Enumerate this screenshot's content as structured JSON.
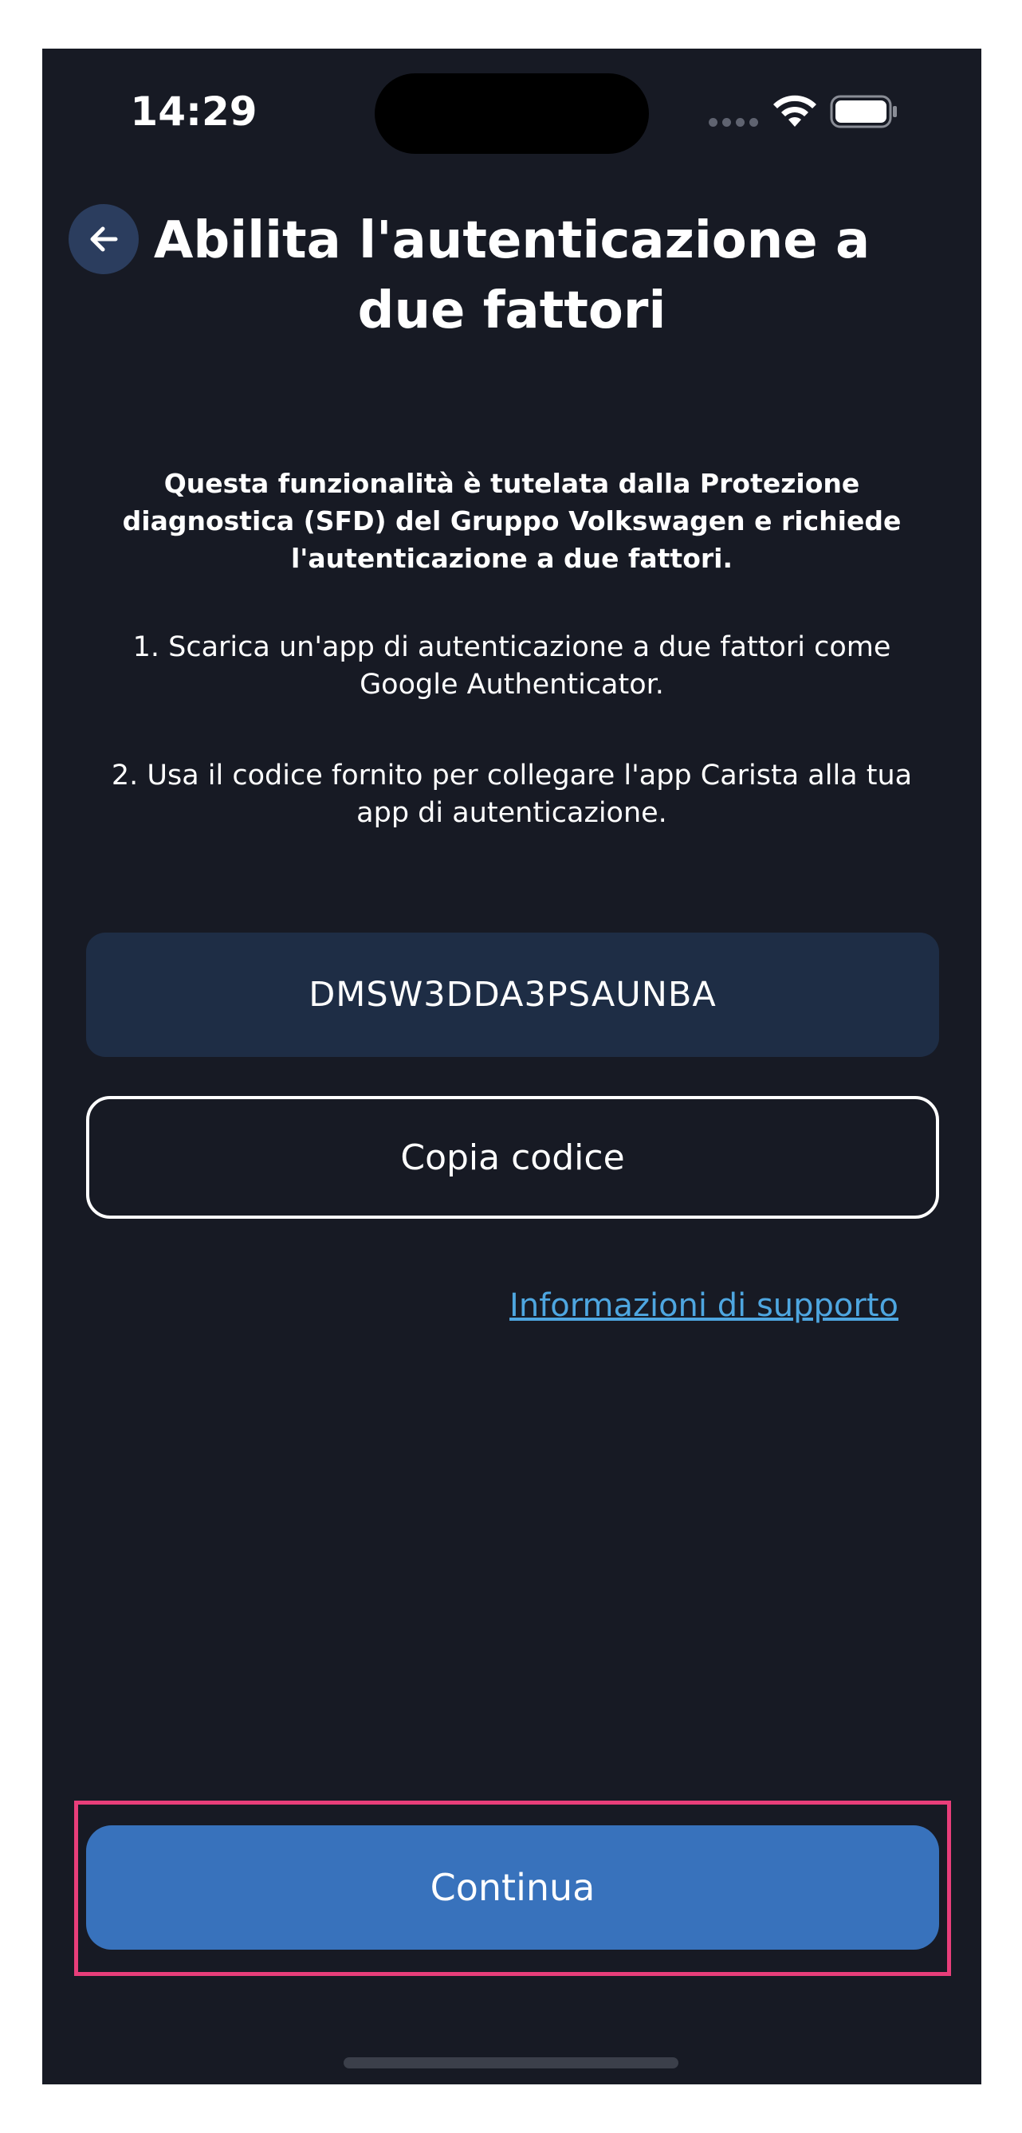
{
  "status_bar": {
    "time": "14:29"
  },
  "header": {
    "title": "Abilita l'autenticazione a due fattori"
  },
  "content": {
    "intro": "Questa funzionalità è tutelata dalla Protezione diagnostica (SFD) del Gruppo Volkswagen e richiede l'autenticazione a due fattori.",
    "step1": "1. Scarica un'app di autenticazione a due fattori come Google Authenticator.",
    "step2": "2. Usa il codice fornito per collegare l'app Carista alla tua app di autenticazione.",
    "code": "DMSW3DDA3PSAUNBA",
    "copy_label": "Copia codice",
    "support_link": "Informazioni di supporto"
  },
  "footer": {
    "continue_label": "Continua"
  },
  "colors": {
    "background": "#171a24",
    "code_box": "#1e2d45",
    "primary": "#3872bc",
    "link": "#4ea6e0",
    "highlight": "#e83e7a"
  }
}
